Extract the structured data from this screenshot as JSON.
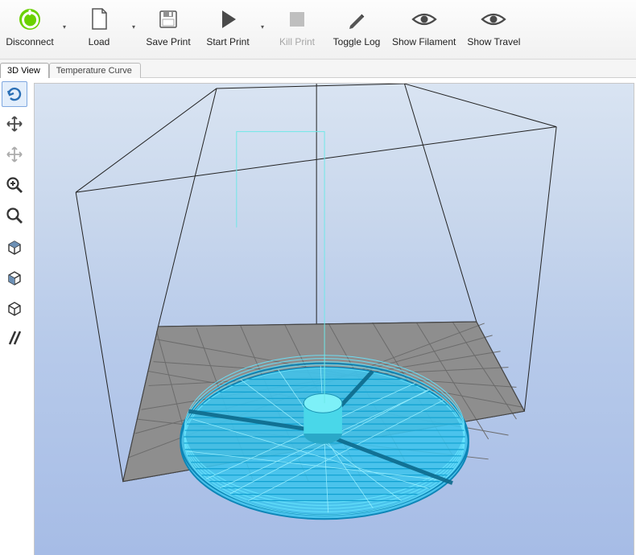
{
  "toolbar": {
    "disconnect": "Disconnect",
    "load": "Load",
    "save_print": "Save Print",
    "start_print": "Start Print",
    "kill_print": "Kill Print",
    "toggle_log": "Toggle Log",
    "show_filament": "Show Filament",
    "show_travel": "Show Travel"
  },
  "tabs": {
    "view3d": "3D View",
    "temperature_curve": "Temperature Curve"
  },
  "viewtools": {
    "rotate": "rotate-icon",
    "move": "move-icon",
    "move_disabled": "move-icon-disabled",
    "zoom": "zoom-icon",
    "fit": "fit-icon",
    "top_view": "top-view-icon",
    "front_view": "front-view-icon",
    "iso_view": "iso-view-icon",
    "parallel": "parallel-lines-icon"
  }
}
